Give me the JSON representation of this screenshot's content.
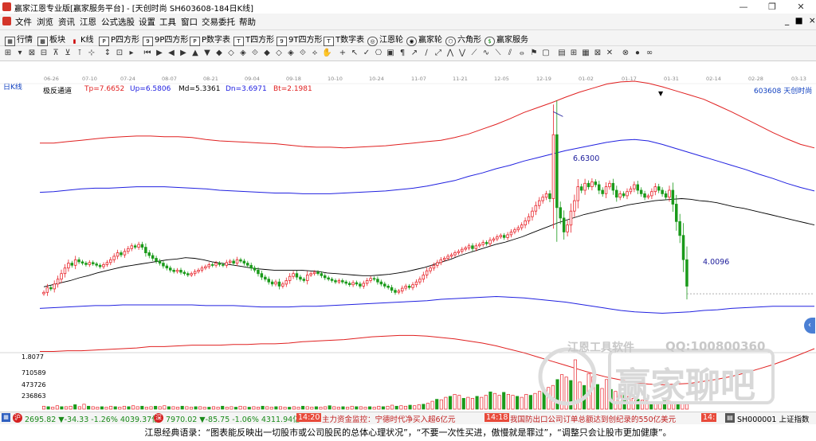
{
  "window": {
    "title": "赢家江恩专业版[赢家服务平台] - [天创时尚  SH603608-184日K线]",
    "minimize": "—",
    "restore": "❐",
    "close": "✕",
    "inner_controls": "_ ■ ×"
  },
  "menu": [
    "文件",
    "浏览",
    "资讯",
    "江恩",
    "公式选股",
    "设置",
    "工具",
    "窗口",
    "交易委托",
    "帮助"
  ],
  "toolbar1": [
    "行情",
    "板块",
    "K线",
    "P四方形",
    "9P四方形",
    "P数字表",
    "T四方形",
    "9T四方形",
    "T数字表",
    "江恩轮",
    "赢家轮",
    "六角形",
    "赢家服务"
  ],
  "chart_label": "日K线",
  "indicator": {
    "name": "极反通道",
    "tp": "Tp=7.6652",
    "up": "Up=6.5806",
    "md": "Md=5.3361",
    "dn": "Dn=3.6971",
    "bt": "Bt=2.1981"
  },
  "stock_label": "603608  天创时尚",
  "date_ticks": [
    "06-26",
    "07-10",
    "07-24",
    "08-07",
    "08-21",
    "09-04",
    "09-18",
    "10-10",
    "10-24",
    "11-07",
    "11-21",
    "12-05",
    "12-19",
    "01-02",
    "01-17",
    "01-31",
    "02-14",
    "02-28",
    "03-13"
  ],
  "annotations": {
    "high": "6.6300",
    "low": "4.0096"
  },
  "volume_axis": [
    "1.8077",
    "710589",
    "473726",
    "236863"
  ],
  "watermark": {
    "line1": "江恩工具软件",
    "qq": "QQ:100800360",
    "logo_text": "赢家聊吧"
  },
  "status": {
    "idx1_badge": "沪",
    "idx1": "2695.82 ▼-34.33 -1.26% 4039.37亿",
    "idx2_badge": "深",
    "idx2": "7970.02 ▼-85.75 -1.06% 4311.94亿",
    "news1_time": "14:20",
    "news1": "主力资金监控：宁德时代净买入超6亿元",
    "news2_time": "14:18",
    "news2": "我国防出口公司订单总额达到创纪录的550亿美元",
    "news3_time": "14:",
    "index_code": "SH000001 上证指数"
  },
  "quote": "江恩经典语录：“图表能反映出一切股市或公司股民的总体心理状况”，“不要一次性买进，傲慢就是罪过”，“调整只会让股市更加健康”。",
  "colors": {
    "up": "#e8242b",
    "down": "#1a9a1a",
    "ma": "#000000",
    "band_outer": "#e02020",
    "band_inner": "#2020e0"
  },
  "chart_data": {
    "type": "candlestick",
    "ylim": [
      3.3,
      7.15
    ],
    "closes": [
      4.03,
      4.1,
      4.08,
      4.15,
      4.22,
      4.3,
      4.38,
      4.45,
      4.42,
      4.5,
      4.47,
      4.45,
      4.43,
      4.46,
      4.44,
      4.42,
      4.4,
      4.43,
      4.46,
      4.5,
      4.55,
      4.6,
      4.57,
      4.62,
      4.66,
      4.7,
      4.68,
      4.72,
      4.68,
      4.6,
      4.56,
      4.52,
      4.48,
      4.45,
      4.41,
      4.38,
      4.35,
      4.33,
      4.35,
      4.32,
      4.3,
      4.28,
      4.3,
      4.33,
      4.35,
      4.38,
      4.4,
      4.43,
      4.42,
      4.45,
      4.43,
      4.42,
      4.46,
      4.48,
      4.45,
      4.5,
      4.48,
      4.45,
      4.42,
      4.38,
      4.35,
      4.3,
      4.25,
      4.22,
      4.18,
      4.15,
      4.18,
      4.12,
      4.15,
      4.2,
      4.26,
      4.3,
      4.25,
      4.22,
      4.2,
      4.28,
      4.3,
      4.32,
      4.3,
      4.27,
      4.24,
      4.22,
      4.2,
      4.18,
      4.2,
      4.18,
      4.16,
      4.14,
      4.17,
      4.15,
      4.12,
      4.16,
      4.2,
      4.23,
      4.22,
      4.18,
      4.15,
      4.12,
      4.1,
      4.06,
      4.03,
      4.05,
      4.09,
      4.12,
      4.1,
      4.14,
      4.18,
      4.22,
      4.28,
      4.34,
      4.38,
      4.42,
      4.46,
      4.5,
      4.52,
      4.55,
      4.57,
      4.6,
      4.62,
      4.65,
      4.67,
      4.7,
      4.66,
      4.7,
      4.72,
      4.75,
      4.73,
      4.78,
      4.8,
      4.83,
      4.85,
      4.82,
      4.86,
      4.9,
      4.93,
      4.96,
      5.0,
      5.06,
      5.12,
      5.2,
      5.28,
      5.35,
      5.4,
      5.45,
      5.38,
      6.3,
      5.25,
      5.1,
      4.9,
      5.0,
      5.2,
      5.35,
      5.55,
      5.5,
      5.6,
      5.55,
      5.62,
      5.58,
      5.5,
      5.45,
      5.55,
      5.6,
      5.5,
      5.4,
      5.45,
      5.42,
      5.48,
      5.52,
      5.58,
      5.5,
      5.45,
      5.4,
      5.42,
      5.48,
      5.55,
      5.5,
      5.45,
      5.4,
      5.5,
      5.3,
      5.05,
      4.85,
      4.5,
      4.12
    ],
    "ma": [
      4.11,
      4.14,
      4.17,
      4.2,
      4.24,
      4.27,
      4.31,
      4.34,
      4.37,
      4.4,
      4.42,
      4.44,
      4.46,
      4.48,
      4.5,
      4.51,
      4.53,
      4.52,
      4.5,
      4.47,
      4.45,
      4.43,
      4.41,
      4.39,
      4.37,
      4.36,
      4.35,
      4.35,
      4.35,
      4.35,
      4.34,
      4.33,
      4.31,
      4.3,
      4.29,
      4.28,
      4.27,
      4.27,
      4.28,
      4.29,
      4.31,
      4.33,
      4.36,
      4.39,
      4.43,
      4.47,
      4.51,
      4.56,
      4.6,
      4.64,
      4.68,
      4.72,
      4.75,
      4.79,
      4.83,
      4.88,
      4.93,
      4.98,
      5.03,
      5.07,
      5.11,
      5.15,
      5.18,
      5.21,
      5.24,
      5.26,
      5.29,
      5.31,
      5.33,
      5.35,
      5.36,
      5.37,
      5.38,
      5.37,
      5.35,
      5.34,
      5.32,
      5.29,
      5.26,
      5.24,
      5.21,
      5.18,
      5.15,
      5.12,
      5.09,
      5.06,
      5.03,
      5.0
    ],
    "band_tp": [
      6.18,
      6.18,
      6.2,
      6.22,
      6.24,
      6.26,
      6.27,
      6.28,
      6.28,
      6.27,
      6.27,
      6.26,
      6.23,
      6.21,
      6.2,
      6.19,
      6.18,
      6.17,
      6.15,
      6.13,
      6.12,
      6.12,
      6.11,
      6.12,
      6.13,
      6.14,
      6.16,
      6.18,
      6.2,
      6.22,
      6.26,
      6.31,
      6.38,
      6.45,
      6.53,
      6.62,
      6.69,
      6.76,
      6.84,
      6.91,
      6.97,
      7.03,
      7.06,
      7.07,
      7.04,
      6.99,
      6.93,
      6.87,
      6.81,
      6.72,
      6.63,
      6.53,
      6.43,
      6.33,
      6.24,
      6.16,
      6.11
    ],
    "band_up": [
      5.47,
      5.48,
      5.5,
      5.52,
      5.53,
      5.53,
      5.54,
      5.55,
      5.55,
      5.55,
      5.54,
      5.53,
      5.52,
      5.5,
      5.49,
      5.48,
      5.47,
      5.46,
      5.46,
      5.45,
      5.45,
      5.45,
      5.46,
      5.47,
      5.48,
      5.49,
      5.51,
      5.53,
      5.56,
      5.6,
      5.64,
      5.7,
      5.75,
      5.81,
      5.86,
      5.92,
      5.97,
      6.02,
      6.07,
      6.11,
      6.15,
      6.19,
      6.22,
      6.23,
      6.21,
      6.16,
      6.1,
      6.04,
      5.98,
      5.92,
      5.86,
      5.8,
      5.73,
      5.67,
      5.6,
      5.54,
      5.49
    ],
    "band_dn": [
      3.8,
      3.81,
      3.82,
      3.83,
      3.84,
      3.84,
      3.85,
      3.85,
      3.85,
      3.85,
      3.85,
      3.85,
      3.84,
      3.84,
      3.84,
      3.83,
      3.82,
      3.82,
      3.82,
      3.83,
      3.83,
      3.84,
      3.85,
      3.86,
      3.87,
      3.88,
      3.89,
      3.9,
      3.91,
      3.93,
      3.94,
      3.95,
      3.96,
      3.97,
      3.96,
      3.95,
      3.93,
      3.91,
      3.89,
      3.86,
      3.83,
      3.8,
      3.77,
      3.75,
      3.74,
      3.73,
      3.74,
      3.75,
      3.77,
      3.78,
      3.8,
      3.81,
      3.82,
      3.83,
      3.83,
      3.83,
      3.83
    ],
    "band_bt": [
      3.18,
      3.18,
      3.19,
      3.19,
      3.2,
      3.21,
      3.22,
      3.23,
      3.25,
      3.25,
      3.26,
      3.27,
      3.27,
      3.27,
      3.28,
      3.28,
      3.29,
      3.29,
      3.3,
      3.32,
      3.33,
      3.34,
      3.35,
      3.37,
      3.39,
      3.4,
      3.41,
      3.41,
      3.4,
      3.38,
      3.36,
      3.33,
      3.3,
      3.26,
      3.21,
      3.16,
      3.1,
      3.04,
      2.98,
      2.92,
      2.86,
      2.81,
      2.77,
      2.73,
      2.71,
      2.7,
      2.71,
      2.72,
      2.75,
      2.78,
      2.82,
      2.87,
      2.93,
      2.99,
      3.06,
      3.14,
      3.22
    ],
    "volume": [
      0.06,
      0.05,
      0.04,
      0.07,
      0.05,
      0.05,
      0.06,
      0.09,
      0.05,
      0.1,
      0.06,
      0.05,
      0.04,
      0.05,
      0.04,
      0.06,
      0.05,
      0.04,
      0.06,
      0.05,
      0.07,
      0.05,
      0.06,
      0.04,
      0.05,
      0.06,
      0.05,
      0.07,
      0.05,
      0.05,
      0.04,
      0.06,
      0.05,
      0.04,
      0.05,
      0.05,
      0.04,
      0.04,
      0.05,
      0.04,
      0.06,
      0.04,
      0.05,
      0.04,
      0.06,
      0.05,
      0.04,
      0.05,
      0.04,
      0.06,
      0.05,
      0.04,
      0.05,
      0.05,
      0.04,
      0.04,
      0.05,
      0.04,
      0.06,
      0.05,
      0.04,
      0.05,
      0.04,
      0.05,
      0.07,
      0.05,
      0.04,
      0.05,
      0.04,
      0.06,
      0.05,
      0.05,
      0.04,
      0.05,
      0.04,
      0.06,
      0.05,
      0.06,
      0.08,
      0.06,
      0.07,
      0.06,
      0.08,
      0.07,
      0.09,
      0.1,
      0.12,
      0.16,
      0.2,
      0.19,
      0.24,
      0.26,
      0.3,
      0.28,
      0.22,
      0.24,
      0.22,
      0.26,
      0.24,
      0.28,
      0.35,
      0.32,
      0.28,
      0.34,
      0.3,
      0.28,
      0.26,
      0.24,
      0.3,
      0.28,
      0.32,
      0.36,
      0.4,
      0.44,
      0.48,
      0.6,
      0.7,
      0.65,
      0.58,
      1.0,
      0.55,
      0.48,
      0.72,
      0.66,
      0.5,
      0.42,
      0.6,
      0.4,
      0.36,
      0.3,
      0.28,
      0.26,
      0.22,
      0.2,
      0.18,
      0.16,
      0.15,
      0.14,
      0.13,
      0.18,
      0.16,
      0.15,
      0.14,
      0.12,
      0.1
    ]
  }
}
